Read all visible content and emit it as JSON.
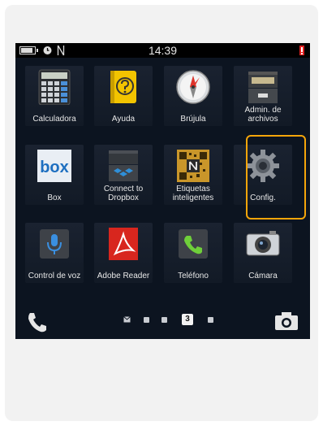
{
  "status": {
    "time": "14:39"
  },
  "apps": [
    {
      "label": "Calculadora",
      "icon": "calculator-icon"
    },
    {
      "label": "Ayuda",
      "icon": "help-icon"
    },
    {
      "label": "Brújula",
      "icon": "compass-icon"
    },
    {
      "label": "Admin. de archivos",
      "icon": "file-manager-icon"
    },
    {
      "label": "Box",
      "icon": "box-icon",
      "logo_text": "box"
    },
    {
      "label": "Connect to Dropbox",
      "icon": "dropbox-icon"
    },
    {
      "label": "Etiquetas inteligentes",
      "icon": "smart-tags-icon"
    },
    {
      "label": "Config.",
      "icon": "settings-gear-icon"
    },
    {
      "label": "Control de voz",
      "icon": "voice-control-icon"
    },
    {
      "label": "Adobe Reader",
      "icon": "adobe-reader-icon"
    },
    {
      "label": "Teléfono",
      "icon": "phone-icon"
    },
    {
      "label": "Cámara",
      "icon": "camera-icon"
    }
  ],
  "bottom": {
    "current_page": "3"
  },
  "colors": {
    "highlight": "#f5a50a",
    "background": "#0c1420"
  }
}
